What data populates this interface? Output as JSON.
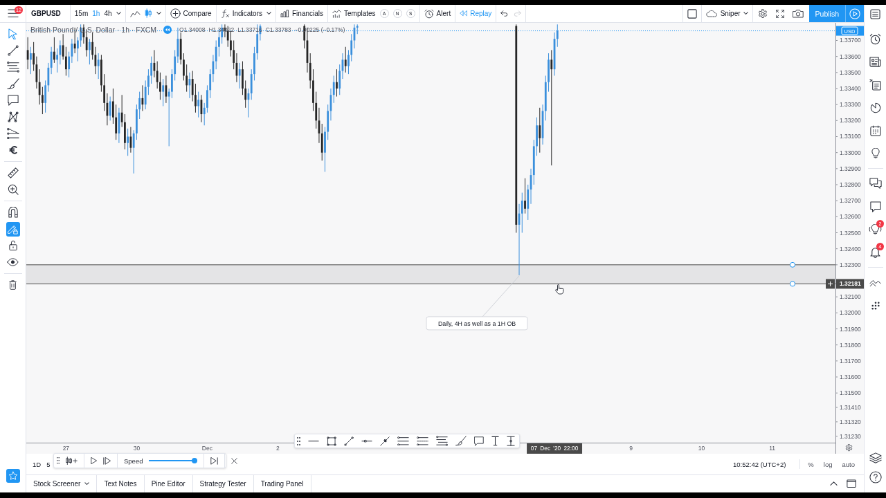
{
  "header": {
    "menu_badge": "12",
    "symbol": "GBPUSD",
    "intervals": [
      {
        "label": "15m",
        "selected": false
      },
      {
        "label": "1h",
        "selected": true
      },
      {
        "label": "4h",
        "selected": false
      }
    ],
    "chart_styles": [
      {
        "kind": "line",
        "selected": false
      },
      {
        "kind": "candles",
        "selected": true
      }
    ],
    "compare": "Compare",
    "indicators": "Indicators",
    "financials": "Financials",
    "templates": "Templates",
    "quick_buttons": [
      "A",
      "N",
      "S"
    ],
    "alert": "Alert",
    "replay": {
      "label": "Replay",
      "on": true
    },
    "history": [
      {
        "kind": "undo",
        "disabled": false
      },
      {
        "kind": "redo",
        "disabled": true
      }
    ],
    "layout_name": "Sniper",
    "publish": "Publish"
  },
  "left_toolbar": {
    "tools": [
      {
        "kind": "cursor",
        "selected": true
      },
      {
        "kind": "trendline",
        "selected": false
      },
      {
        "kind": "fibonacci",
        "selected": false
      },
      {
        "kind": "brush",
        "selected": false
      },
      {
        "kind": "note",
        "selected": false
      },
      {
        "kind": "pattern",
        "selected": false
      },
      {
        "kind": "projection",
        "selected": false
      },
      {
        "kind": "euro",
        "selected": false
      },
      {
        "kind": "ruler",
        "selected": false
      },
      {
        "kind": "zoom",
        "selected": false
      }
    ],
    "toggles": [
      {
        "kind": "magnet",
        "on": false
      },
      {
        "kind": "drawing_mode",
        "on": true
      },
      {
        "kind": "lock",
        "on": false
      },
      {
        "kind": "visibility",
        "on": false
      }
    ]
  },
  "chart": {
    "legend": {
      "title": "British Pound / U.S. Dollar · 1h · FXCM",
      "values": [
        "O1.34008",
        "H1.34022",
        "L1.33716",
        "C1.33783",
        "−0.00225 (−0.17%)"
      ]
    },
    "currency": "USD",
    "crosshair": {
      "price": "1.32181",
      "time": "07 Dec '20 22:00"
    },
    "chart_data": {
      "type": "candlestick",
      "categories": [
        null,
        null,
        null,
        null,
        null,
        null,
        null,
        null,
        null,
        null,
        null,
        null,
        null,
        "27",
        null,
        null,
        null,
        null,
        null,
        null,
        null,
        null,
        null,
        null,
        null,
        null,
        null,
        null,
        null,
        null,
        null,
        null,
        null,
        null,
        null,
        null,
        null,
        "30",
        null,
        null,
        null,
        null,
        null,
        null,
        null,
        null,
        null,
        null,
        null,
        null,
        null,
        null,
        null,
        null,
        null,
        null,
        null,
        null,
        null,
        null,
        null,
        "Dec",
        null,
        null,
        null,
        null,
        null,
        null,
        null,
        null,
        null,
        null,
        null,
        null,
        null,
        null,
        null,
        null,
        null,
        null,
        null,
        null,
        null,
        null,
        null,
        "2",
        null,
        null,
        null,
        null,
        null,
        null,
        null,
        null,
        null,
        null,
        null,
        null,
        null,
        null,
        null,
        null,
        null,
        null,
        null,
        null,
        null,
        null,
        null,
        null,
        null,
        null,
        null,
        null,
        null,
        null,
        null,
        null,
        null,
        null,
        null,
        null,
        null,
        null,
        null,
        null,
        null,
        null,
        null,
        null,
        null,
        null,
        null,
        null,
        null,
        null,
        null,
        null,
        null,
        null,
        null,
        null,
        null,
        null,
        null,
        null,
        null,
        null,
        null,
        null,
        null,
        null,
        null,
        null,
        null,
        null,
        null,
        null,
        null,
        null,
        null,
        null,
        null,
        null,
        null,
        null,
        null,
        null,
        null,
        null,
        null,
        null,
        null,
        null,
        null,
        null,
        null,
        null,
        null,
        null,
        null,
        null,
        null,
        null,
        null,
        null,
        null,
        null,
        null,
        null,
        null,
        null,
        null,
        null,
        null,
        null,
        null,
        null,
        null,
        null,
        null,
        null,
        null,
        null,
        null,
        "9",
        null,
        null,
        null,
        null,
        null,
        null,
        null,
        null,
        null,
        null,
        null,
        null,
        null,
        null,
        null,
        null,
        null,
        null,
        null,
        null,
        null,
        null,
        null,
        "10",
        null,
        null,
        null,
        null,
        null,
        null,
        null,
        null,
        null,
        null,
        null,
        null,
        null,
        null,
        null,
        null,
        null,
        null,
        null,
        null,
        null,
        null,
        null,
        "11",
        null,
        null,
        null,
        null,
        null,
        null,
        null,
        null,
        null,
        null,
        null,
        null,
        null,
        null,
        null,
        null,
        null,
        null,
        null,
        null,
        null
      ],
      "ohlc": [
        [
          1.3364,
          1.3372,
          1.3352,
          1.3358
        ],
        [
          1.3358,
          1.3366,
          1.3349,
          1.3362
        ],
        [
          1.3362,
          1.3369,
          1.3351,
          1.3355
        ],
        [
          1.3355,
          1.336,
          1.334,
          1.3344
        ],
        [
          1.3344,
          1.3352,
          1.333,
          1.3336
        ],
        [
          1.3336,
          1.3341,
          1.3324,
          1.3331
        ],
        [
          1.3331,
          1.3345,
          1.3325,
          1.3342
        ],
        [
          1.3342,
          1.3356,
          1.3338,
          1.3353
        ],
        [
          1.3353,
          1.3366,
          1.3349,
          1.3363
        ],
        [
          1.3363,
          1.3372,
          1.3356,
          1.3358
        ],
        [
          1.3358,
          1.3365,
          1.335,
          1.3361
        ],
        [
          1.3361,
          1.337,
          1.3355,
          1.3367
        ],
        [
          1.3367,
          1.3374,
          1.3358,
          1.336
        ],
        [
          1.336,
          1.3366,
          1.3348,
          1.3352
        ],
        [
          1.3352,
          1.3363,
          1.3347,
          1.336
        ],
        [
          1.336,
          1.3371,
          1.3356,
          1.3368
        ],
        [
          1.3368,
          1.3378,
          1.3362,
          1.3365
        ],
        [
          1.3365,
          1.3372,
          1.3357,
          1.337
        ],
        [
          1.337,
          1.338,
          1.3366,
          1.3378
        ],
        [
          1.3378,
          1.338,
          1.3368,
          1.3372
        ],
        [
          1.3372,
          1.3377,
          1.336,
          1.3364
        ],
        [
          1.3364,
          1.3371,
          1.3355,
          1.3369
        ],
        [
          1.3369,
          1.3375,
          1.3358,
          1.3361
        ],
        [
          1.3361,
          1.3366,
          1.3349,
          1.3354
        ],
        [
          1.3354,
          1.3362,
          1.3346,
          1.3358
        ],
        [
          1.3358,
          1.3361,
          1.3338,
          1.3342
        ],
        [
          1.3342,
          1.3349,
          1.3326,
          1.3331
        ],
        [
          1.3331,
          1.3337,
          1.3317,
          1.3323
        ],
        [
          1.3323,
          1.3335,
          1.332,
          1.3332
        ],
        [
          1.3332,
          1.334,
          1.3318,
          1.3322
        ],
        [
          1.3322,
          1.333,
          1.3308,
          1.3312
        ],
        [
          1.3312,
          1.3328,
          1.3306,
          1.3325
        ],
        [
          1.3325,
          1.3336,
          1.3316,
          1.3319
        ],
        [
          1.3319,
          1.3324,
          1.3302,
          1.3306
        ],
        [
          1.3306,
          1.3315,
          1.3298,
          1.331
        ],
        [
          1.331,
          1.3316,
          1.33,
          1.3303
        ],
        [
          1.3303,
          1.3314,
          1.3287,
          1.3312
        ],
        [
          1.3312,
          1.333,
          1.3308,
          1.3327
        ],
        [
          1.3327,
          1.3338,
          1.3321,
          1.3334
        ],
        [
          1.3334,
          1.3342,
          1.3326,
          1.333
        ],
        [
          1.333,
          1.3345,
          1.3327,
          1.3341
        ],
        [
          1.3341,
          1.3352,
          1.3336,
          1.3348
        ],
        [
          1.3348,
          1.336,
          1.3343,
          1.3356
        ],
        [
          1.3356,
          1.3364,
          1.3347,
          1.3351
        ],
        [
          1.3351,
          1.3357,
          1.334,
          1.3344
        ],
        [
          1.3344,
          1.335,
          1.3333,
          1.3338
        ],
        [
          1.3338,
          1.3346,
          1.3329,
          1.3342
        ],
        [
          1.3342,
          1.3348,
          1.3331,
          1.3335
        ],
        [
          1.3335,
          1.334,
          1.3304,
          1.3338
        ],
        [
          1.3338,
          1.3352,
          1.3334,
          1.3349
        ],
        [
          1.3349,
          1.3364,
          1.3345,
          1.336
        ],
        [
          1.336,
          1.3378,
          1.3356,
          1.3371
        ],
        [
          1.3371,
          1.3375,
          1.3355,
          1.3358
        ],
        [
          1.3358,
          1.3362,
          1.3345,
          1.3348
        ],
        [
          1.3348,
          1.3355,
          1.3338,
          1.3342
        ],
        [
          1.3342,
          1.335,
          1.3334,
          1.3346
        ],
        [
          1.3346,
          1.3351,
          1.3332,
          1.3336
        ],
        [
          1.3336,
          1.3343,
          1.3325,
          1.3329
        ],
        [
          1.3329,
          1.3338,
          1.3322,
          1.3333
        ],
        [
          1.3333,
          1.3336,
          1.3319,
          1.3324
        ],
        [
          1.3324,
          1.3331,
          1.3317,
          1.3328
        ],
        [
          1.3328,
          1.3342,
          1.3325,
          1.3339
        ],
        [
          1.3339,
          1.3352,
          1.3334,
          1.3349
        ],
        [
          1.3349,
          1.3361,
          1.3344,
          1.3357
        ],
        [
          1.3357,
          1.337,
          1.3352,
          1.3366
        ],
        [
          1.3366,
          1.3377,
          1.336,
          1.3372
        ],
        [
          1.3372,
          1.338,
          1.3368,
          1.3378
        ],
        [
          1.3378,
          1.338,
          1.3372,
          1.3376
        ],
        [
          1.3376,
          1.3379,
          1.3366,
          1.337
        ],
        [
          1.337,
          1.3376,
          1.336,
          1.3364
        ],
        [
          1.3364,
          1.337,
          1.3352,
          1.3356
        ],
        [
          1.3356,
          1.3362,
          1.3344,
          1.3348
        ],
        [
          1.3348,
          1.3356,
          1.334,
          1.3352
        ],
        [
          1.3352,
          1.3357,
          1.3336,
          1.334
        ],
        [
          1.334,
          1.3345,
          1.3328,
          1.3333
        ],
        [
          1.3333,
          1.334,
          1.3322,
          1.3337
        ],
        [
          1.3337,
          1.3352,
          1.3333,
          1.3349
        ],
        [
          1.3349,
          1.3366,
          1.3345,
          1.3362
        ],
        [
          1.3362,
          1.338,
          1.3358,
          1.3374
        ],
        [
          1.3374,
          1.338,
          1.337,
          1.3379
        ],
        null,
        null,
        null,
        null,
        null,
        null,
        null,
        null,
        null,
        null,
        null,
        null,
        null,
        null,
        [
          1.3379,
          1.338,
          1.3365,
          1.337
        ],
        [
          1.337,
          1.3378,
          1.335,
          1.3356
        ],
        [
          1.3356,
          1.3362,
          1.334,
          1.3345
        ],
        [
          1.3345,
          1.3352,
          1.3326,
          1.3331
        ],
        [
          1.3331,
          1.3338,
          1.3315,
          1.332
        ],
        [
          1.332,
          1.3328,
          1.3306,
          1.3312
        ],
        [
          1.3312,
          1.3318,
          1.3295,
          1.33
        ],
        [
          1.33,
          1.3316,
          1.3288,
          1.3313
        ],
        [
          1.3313,
          1.333,
          1.3308,
          1.3326
        ],
        [
          1.3326,
          1.334,
          1.332,
          1.3336
        ],
        [
          1.3336,
          1.3348,
          1.3331,
          1.3344
        ],
        [
          1.3344,
          1.3352,
          1.3335,
          1.334
        ],
        [
          1.334,
          1.3355,
          1.3336,
          1.3351
        ],
        [
          1.3351,
          1.3362,
          1.3346,
          1.3358
        ],
        [
          1.3358,
          1.3366,
          1.335,
          1.3354
        ],
        [
          1.3354,
          1.3364,
          1.3349,
          1.3361
        ],
        [
          1.3361,
          1.3374,
          1.3357,
          1.337
        ],
        [
          1.337,
          1.338,
          1.3365,
          1.3378
        ],
        [
          1.3378,
          1.338,
          1.3374,
          1.3379
        ],
        null,
        null,
        null,
        null,
        null,
        null,
        null,
        null,
        null,
        null,
        null,
        null,
        null,
        null,
        null,
        null,
        null,
        null,
        null,
        null,
        null,
        null,
        null,
        null,
        null,
        null,
        null,
        null,
        null,
        null,
        null,
        null,
        null,
        null,
        null,
        null,
        null,
        null,
        null,
        null,
        null,
        null,
        null,
        null,
        null,
        null,
        null,
        null,
        null,
        null,
        null,
        null,
        null,
        [
          1.3379,
          1.338,
          1.325,
          1.3255
        ],
        [
          1.3255,
          1.3268,
          1.32235,
          1.3262
        ],
        [
          1.3262,
          1.3275,
          1.325,
          1.327
        ],
        [
          1.327,
          1.3284,
          1.3262,
          1.3265
        ],
        [
          1.3265,
          1.328,
          1.3258,
          1.3277
        ],
        [
          1.3277,
          1.329,
          1.3268,
          1.3286
        ],
        [
          1.3286,
          1.3308,
          1.328,
          1.3304
        ],
        [
          1.3304,
          1.3322,
          1.3298,
          1.3317
        ],
        [
          1.3317,
          1.3328,
          1.33,
          1.3309
        ],
        [
          1.3309,
          1.333,
          1.3305,
          1.3326
        ],
        [
          1.3326,
          1.3348,
          1.332,
          1.3344
        ],
        [
          1.3344,
          1.3362,
          1.3338,
          1.3358
        ],
        [
          1.3358,
          1.3364,
          1.3292,
          1.3352
        ],
        [
          1.3352,
          1.3375,
          1.3348,
          1.3371
        ],
        [
          1.3371,
          1.338,
          1.3366,
          1.3376
        ],
        null,
        null,
        null,
        null,
        null,
        null,
        null,
        null,
        null,
        null,
        null,
        null,
        null,
        null,
        null,
        null,
        null,
        null,
        null,
        null,
        null,
        null,
        null,
        null,
        null,
        null,
        null,
        null,
        null,
        null,
        null,
        null,
        null,
        null,
        null,
        null,
        null,
        null,
        null,
        null,
        null,
        null,
        null,
        null,
        null,
        null,
        null,
        null,
        null,
        null,
        null,
        null,
        null,
        null,
        null,
        null,
        null,
        null,
        null,
        null,
        null,
        null,
        null,
        null,
        null,
        null,
        null,
        null,
        null,
        null,
        null,
        null,
        null,
        null,
        null,
        null,
        null,
        null,
        null,
        null,
        null,
        null,
        null,
        null,
        null,
        null,
        null,
        null,
        null,
        null,
        null,
        null,
        null,
        null
      ],
      "ylim": [
        1.3119,
        1.3381
      ],
      "yticks": [
        {
          "value": 1.337,
          "label": "1.33700"
        },
        {
          "value": 1.336,
          "label": "1.33600"
        },
        {
          "value": 1.335,
          "label": "1.33500"
        },
        {
          "value": 1.334,
          "label": "1.33400"
        },
        {
          "value": 1.333,
          "label": "1.33300"
        },
        {
          "value": 1.332,
          "label": "1.33200"
        },
        {
          "value": 1.331,
          "label": "1.33100"
        },
        {
          "value": 1.33,
          "label": "1.33000"
        },
        {
          "value": 1.329,
          "label": "1.32900"
        },
        {
          "value": 1.328,
          "label": "1.32800"
        },
        {
          "value": 1.327,
          "label": "1.32700"
        },
        {
          "value": 1.326,
          "label": "1.32600"
        },
        {
          "value": 1.325,
          "label": "1.32500"
        },
        {
          "value": 1.324,
          "label": "1.32400"
        },
        {
          "value": 1.323,
          "label": "1.32300"
        },
        {
          "value": 1.321,
          "label": "1.32100"
        },
        {
          "value": 1.32,
          "label": "1.32000"
        },
        {
          "value": 1.319,
          "label": "1.31900"
        },
        {
          "value": 1.318,
          "label": "1.31800"
        },
        {
          "value": 1.317,
          "label": "1.31700"
        },
        {
          "value": 1.316,
          "label": "1.31600"
        },
        {
          "value": 1.315,
          "label": "1.31500"
        },
        {
          "value": 1.3141,
          "label": "1.31410"
        },
        {
          "value": 1.3132,
          "label": "1.31320"
        },
        {
          "value": 1.3123,
          "label": "1.31230"
        }
      ],
      "ref_lines": [
        {
          "axis": "y",
          "value": 1.3376,
          "color": "#2196f3",
          "line_style": "dotted"
        }
      ],
      "bands": [
        {
          "axis": "y",
          "from": 1.32181,
          "to": 1.323
        }
      ],
      "annotations": [
        "Daily, 4H as well as a 1H OB"
      ]
    }
  },
  "replay_bar": {
    "speed_label": "Speed",
    "speed": {
      "level": 1
    }
  },
  "bottom_bar": {
    "ranges": [
      "1D",
      "5"
    ],
    "clock": "10:52:42 (UTC+2)",
    "scale_options": [
      "%",
      "log",
      "auto"
    ]
  },
  "bottom_tabs": [
    {
      "label": "Stock Screener",
      "has_menu": true
    },
    {
      "label": "Text Notes",
      "has_menu": false
    },
    {
      "label": "Pine Editor",
      "has_menu": false
    },
    {
      "label": "Strategy Tester",
      "has_menu": false
    },
    {
      "label": "Trading Panel",
      "has_menu": false
    }
  ],
  "right_sidebar": {
    "ideas_badge": "2",
    "alerts_badge": "4"
  }
}
